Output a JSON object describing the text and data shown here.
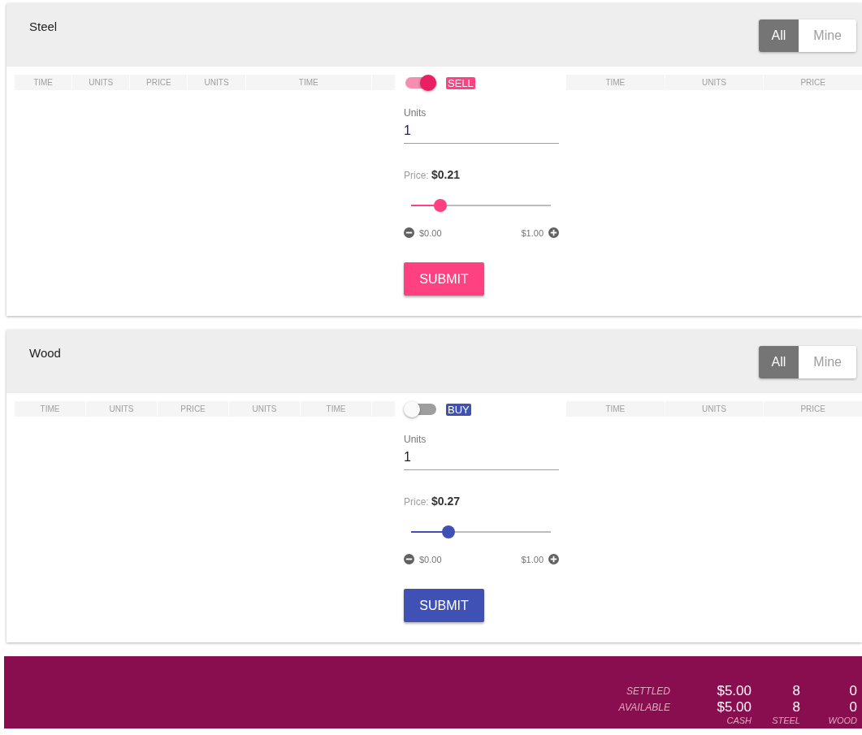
{
  "markets": [
    {
      "name": "Steel",
      "filters": [
        {
          "label": "All",
          "selected": true
        },
        {
          "label": "Mine",
          "selected": false
        }
      ],
      "book_columns": [
        "TIME",
        "UNITS",
        "PRICE",
        "UNITS",
        "TIME"
      ],
      "order": {
        "kind": "sell",
        "on": true,
        "side_label": "SELL",
        "units_label": "Units",
        "units_value": "1",
        "price_label": "Price:",
        "price_value": "$0.21",
        "level": 0.21,
        "min": "$0.00",
        "max": "$1.00",
        "submit": "SUBMIT"
      },
      "trade_columns": [
        "TIME",
        "UNITS",
        "PRICE"
      ]
    },
    {
      "name": "Wood",
      "filters": [
        {
          "label": "All",
          "selected": true
        },
        {
          "label": "Mine",
          "selected": false
        }
      ],
      "book_columns": [
        "TIME",
        "UNITS",
        "PRICE",
        "UNITS",
        "TIME"
      ],
      "order": {
        "kind": "buy",
        "on": false,
        "side_label": "BUY",
        "units_label": "Units",
        "units_value": "1",
        "price_label": "Price:",
        "price_value": "$0.27",
        "level": 0.27,
        "min": "$0.00",
        "max": "$1.00",
        "submit": "SUBMIT"
      },
      "trade_columns": [
        "TIME",
        "UNITS",
        "PRICE"
      ]
    }
  ],
  "balances": {
    "rows": [
      {
        "label": "SETTLED",
        "values": [
          "$5.00",
          "8",
          "0"
        ]
      },
      {
        "label": "AVAILABLE",
        "values": [
          "$5.00",
          "8",
          "0"
        ]
      }
    ],
    "columns": [
      "CASH",
      "STEEL",
      "WOOD"
    ]
  }
}
